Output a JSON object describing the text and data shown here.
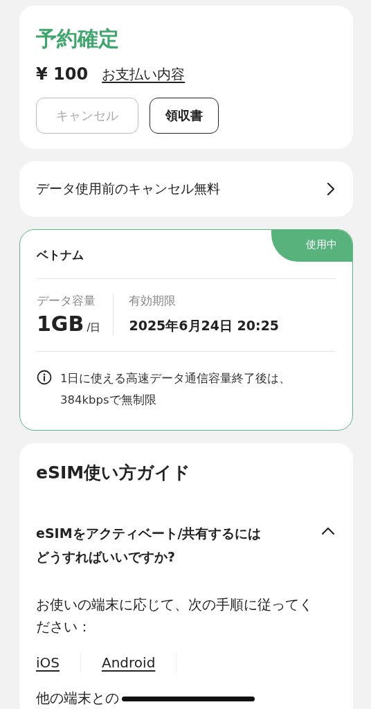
{
  "booking": {
    "status": "予約確定",
    "price": "¥ 100",
    "payment_link": "お支払い内容",
    "buttons": [
      {
        "label": "キャンセル",
        "disabled": true
      },
      {
        "label": "領収書",
        "disabled": false
      }
    ]
  },
  "cancel_policy": {
    "label": "データ使用前のキャンセル無料"
  },
  "plan": {
    "country": "ベトナム",
    "badge": "使用中",
    "active": true,
    "data_label": "データ容量",
    "data_value": "1GB",
    "data_unit": "/日",
    "expiry_label": "有効期限",
    "expiry_value": "2025年6月24日 20:25",
    "note": "1日に使える高速データ通信容量終了後は、384kbpsで無制限"
  },
  "guide": {
    "title": "eSIM使い方ガイド",
    "faq": {
      "question": "eSIMをアクティベート/共有するにはどうすればいいですか?",
      "expanded": true
    },
    "intro": "お使いの端末に応じて、次の手順に従ってください：",
    "platforms": [
      {
        "label": "iOS"
      },
      {
        "label": "Android"
      }
    ],
    "share_heading": "他の端末との"
  }
}
